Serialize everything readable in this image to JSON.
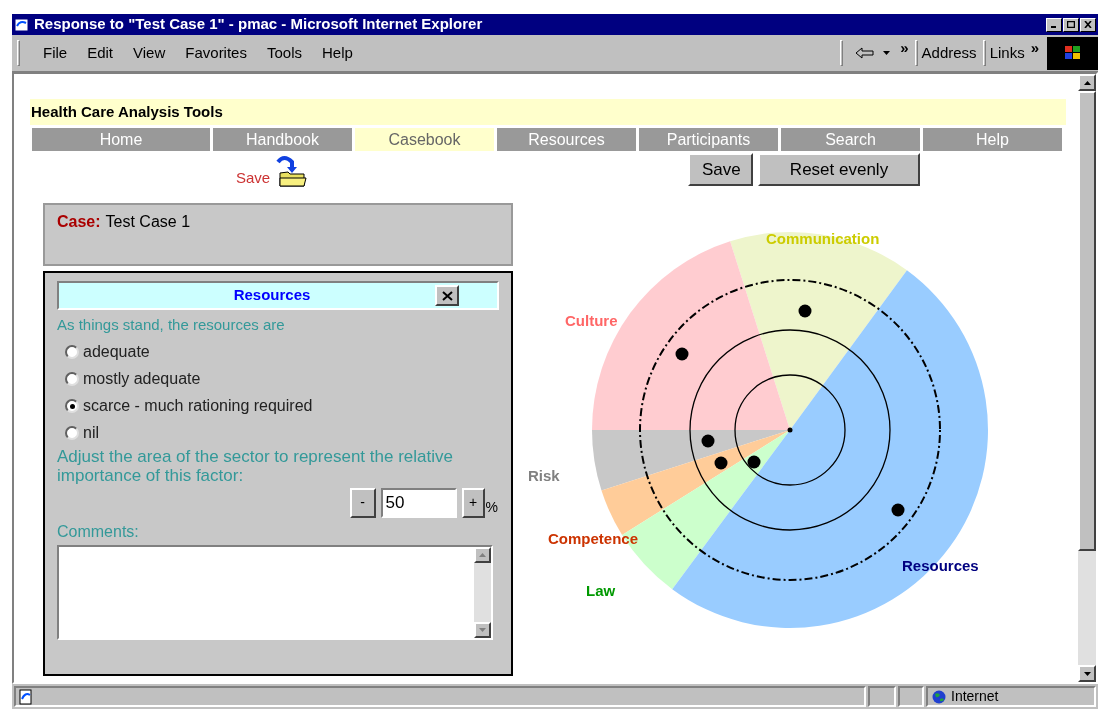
{
  "window": {
    "title": "Response to \"Test Case 1\" - pmac - Microsoft Internet Explorer"
  },
  "menu": [
    "File",
    "Edit",
    "View",
    "Favorites",
    "Tools",
    "Help"
  ],
  "toolbar": {
    "chevron": "»",
    "address": "Address",
    "links": "Links",
    "links_chevron": "»"
  },
  "site_title": "Health Care Analysis Tools",
  "nav": [
    {
      "label": "Home",
      "selected": false
    },
    {
      "label": "Handbook",
      "selected": false
    },
    {
      "label": "Casebook",
      "selected": true
    },
    {
      "label": "Resources",
      "selected": false
    },
    {
      "label": "Participants",
      "selected": false
    },
    {
      "label": "Search",
      "selected": false
    },
    {
      "label": "Help",
      "selected": false
    }
  ],
  "save_link": "Save",
  "buttons": [
    "Save",
    "Reset evenly"
  ],
  "case": {
    "label": "Case:",
    "value": "Test Case 1"
  },
  "panel": {
    "title": "Resources",
    "prompt": "As things stand, the resources are",
    "options": [
      {
        "label": "adequate",
        "selected": false
      },
      {
        "label": "mostly adequate",
        "selected": false
      },
      {
        "label": "scarce - much rationing required",
        "selected": true
      },
      {
        "label": "nil",
        "selected": false
      }
    ],
    "adjust_text": "Adjust the area of the sector to represent the relative importance of this factor:",
    "decrement": "-",
    "value": "50",
    "increment": "+",
    "unit": "%",
    "comments_label": "Comments:"
  },
  "chart": {
    "sectors": [
      {
        "color": "#eef5cc"
      },
      {
        "color": "#ffccd0"
      },
      {
        "color": "#c8c8c8"
      },
      {
        "color": "#ffcc99"
      },
      {
        "color": "#ccffcc"
      },
      {
        "color": "#99ccff"
      }
    ],
    "labels": [
      {
        "label": "Communication",
        "color": "#cccc00"
      },
      {
        "label": "Culture",
        "color": "#ff6666"
      },
      {
        "label": "Risk",
        "color": "#808080"
      },
      {
        "label": "Competence",
        "color": "#cc3300"
      },
      {
        "label": "Law",
        "color": "#009900"
      },
      {
        "label": "Resources",
        "color": "#000080"
      }
    ]
  },
  "status_bar": {
    "zone": "Internet"
  }
}
